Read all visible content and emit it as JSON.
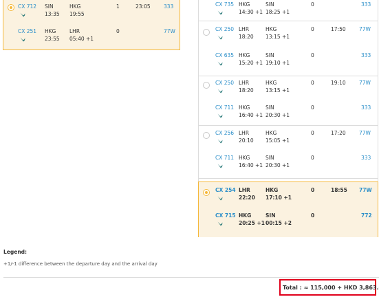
{
  "left_option": {
    "segments": [
      {
        "flight": "CX 712",
        "from": "SIN",
        "to": "HKG",
        "dep": "13:35",
        "arr": "19:55",
        "stops": "1",
        "duration": "23:05",
        "aircraft": "333"
      },
      {
        "flight": "CX 251",
        "from": "HKG",
        "to": "LHR",
        "dep": "23:55",
        "arr": "05:40 +1",
        "stops": "0",
        "duration": "",
        "aircraft": "77W"
      }
    ]
  },
  "right_options": [
    {
      "segments": [
        {
          "flight": "CX 735",
          "from": "HKG",
          "to": "SIN",
          "dep": "14:30 +1",
          "arr": "18:25 +1",
          "stops": "0",
          "duration": "",
          "aircraft": "333"
        }
      ]
    },
    {
      "segments": [
        {
          "flight": "CX 250",
          "from": "LHR",
          "to": "HKG",
          "dep": "18:20",
          "arr": "13:15 +1",
          "stops": "0",
          "duration": "17:50",
          "aircraft": "77W"
        },
        {
          "flight": "CX 635",
          "from": "HKG",
          "to": "SIN",
          "dep": "15:20 +1",
          "arr": "19:10 +1",
          "stops": "0",
          "duration": "",
          "aircraft": "333"
        }
      ]
    },
    {
      "segments": [
        {
          "flight": "CX 250",
          "from": "LHR",
          "to": "HKG",
          "dep": "18:20",
          "arr": "13:15 +1",
          "stops": "0",
          "duration": "19:10",
          "aircraft": "77W"
        },
        {
          "flight": "CX 711",
          "from": "HKG",
          "to": "SIN",
          "dep": "16:40 +1",
          "arr": "20:30 +1",
          "stops": "0",
          "duration": "",
          "aircraft": "333"
        }
      ]
    },
    {
      "segments": [
        {
          "flight": "CX 256",
          "from": "LHR",
          "to": "HKG",
          "dep": "20:10",
          "arr": "15:05 +1",
          "stops": "0",
          "duration": "17:20",
          "aircraft": "77W"
        },
        {
          "flight": "CX 711",
          "from": "HKG",
          "to": "SIN",
          "dep": "16:40 +1",
          "arr": "20:30 +1",
          "stops": "0",
          "duration": "",
          "aircraft": "333"
        }
      ]
    },
    {
      "segments": [
        {
          "flight": "CX 254",
          "from": "LHR",
          "to": "HKG",
          "dep": "22:20",
          "arr": "17:10 +1",
          "stops": "0",
          "duration": "18:55",
          "aircraft": "77W"
        },
        {
          "flight": "CX 715",
          "from": "HKG",
          "to": "SIN",
          "dep": "20:25 +1",
          "arr": "00:15 +2",
          "stops": "0",
          "duration": "",
          "aircraft": "772"
        }
      ]
    }
  ],
  "legend": {
    "title": "Legend:",
    "text": "+1/-1 difference between the departure day and the arrival day"
  },
  "total": {
    "text": "Total : ≈ 115,000 + HKD 3,863.00"
  },
  "colors": {
    "accent": "#f5b83a",
    "selected_bg": "#fbf2e0",
    "link": "#2a8ec9",
    "highlight_border": "#e0001b"
  },
  "icons": {
    "airline_logo": "cathay-brushwing-icon",
    "radio": "radio-button-icon"
  }
}
